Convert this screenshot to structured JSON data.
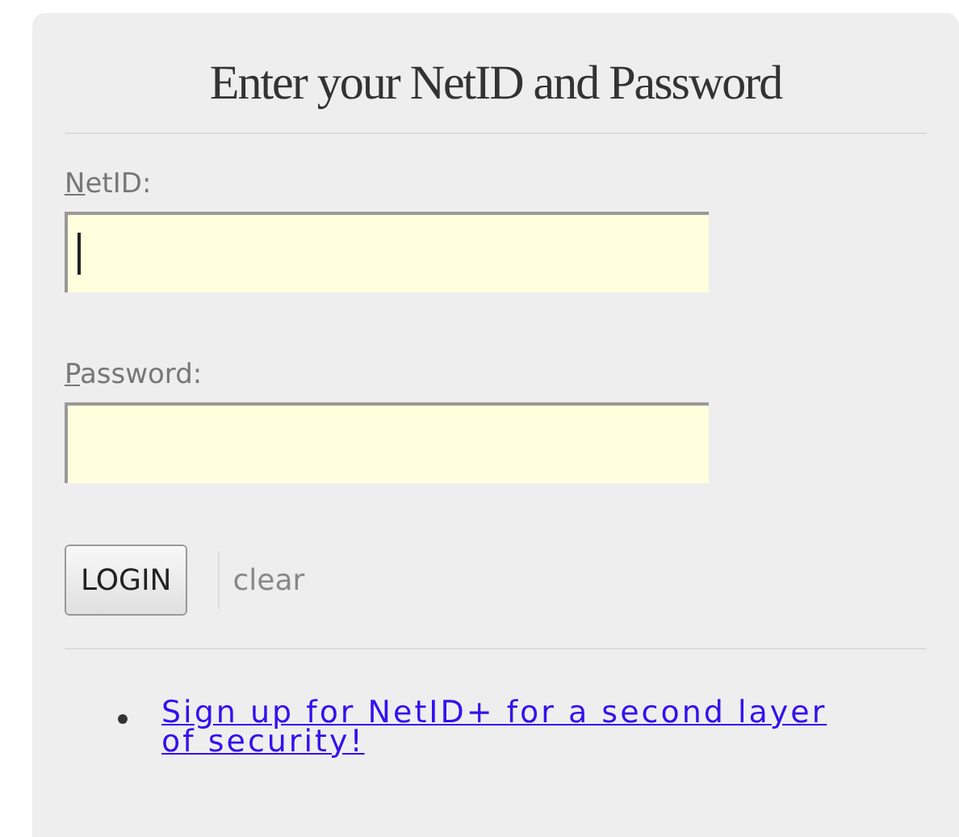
{
  "heading": "Enter your NetID and Password",
  "fields": [
    {
      "access_key": "N",
      "label_rest": "etID:",
      "focused": true
    },
    {
      "access_key": "P",
      "label_rest": "assword:",
      "focused": false
    }
  ],
  "login_button": "LOGIN",
  "clear_link": "clear",
  "links": [
    "Sign up for NetID+ for a second layer of security!"
  ]
}
